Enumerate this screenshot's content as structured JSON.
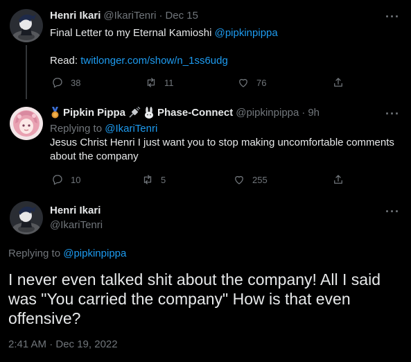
{
  "tweet1": {
    "name": "Henri Ikari",
    "handle": "@IkariTenri",
    "sep": "·",
    "date": "Dec 15",
    "text_prefix": "Final Letter to my Eternal Kamioshi ",
    "mention": "@pipkinpippa",
    "read_prefix": "Read: ",
    "link": "twitlonger.com/show/n_1ss6udg",
    "replies": "38",
    "retweets": "11",
    "likes": "76",
    "more": "···"
  },
  "tweet2": {
    "name": "Pipkin Pippa",
    "name_suffix": "Phase-Connect",
    "handle": "@pipkinpippa",
    "sep": "·",
    "date": "9h",
    "replying_prefix": "Replying to ",
    "replying_handle": "@IkariTenri",
    "text": "Jesus Christ Henri I just want you to stop making uncomfortable comments about the company",
    "replies": "10",
    "retweets": "5",
    "likes": "255",
    "more": "···"
  },
  "tweet3": {
    "name": "Henri Ikari",
    "handle": "@IkariTenri",
    "replying_prefix": "Replying to ",
    "replying_handle": "@pipkinpippa",
    "text": "I never even talked shit about the company! All I said was \"You carried the company\" How is that even offensive?",
    "timestamp": "2:41 AM · Dec 19, 2022",
    "more": "···"
  },
  "icons": {
    "reply": "reply-icon",
    "retweet": "retweet-icon",
    "like": "heart-icon",
    "share": "share-icon",
    "medal": "medal-icon",
    "plug": "plug-icon",
    "rabbit": "rabbit-icon"
  },
  "colors": {
    "background": "#000000",
    "text": "#e7e9ea",
    "muted": "#71767b",
    "link": "#1d9bf0",
    "thread_line": "#333639"
  }
}
